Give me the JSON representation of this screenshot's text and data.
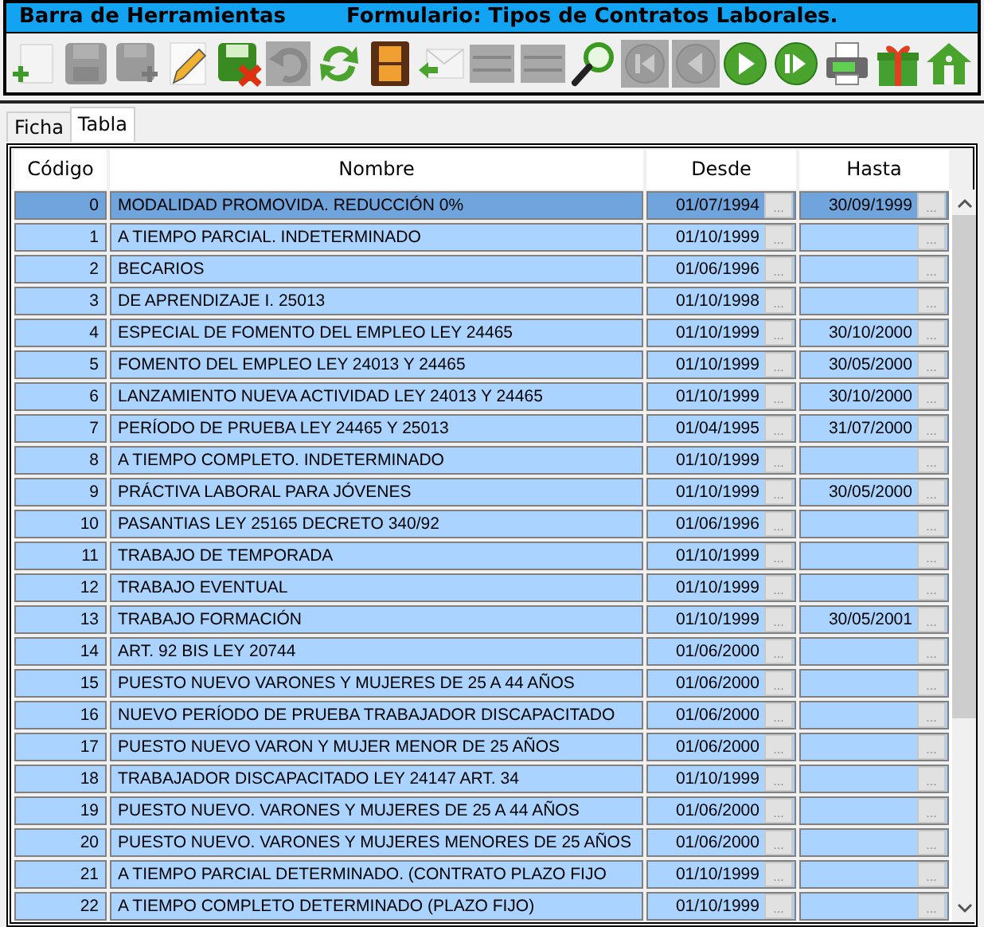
{
  "title_bar": {
    "toolbar_label": "Barra de Herramientas",
    "form_title": "Formulario: Tipos de Contratos Laborales."
  },
  "toolbar": [
    {
      "kind": "new",
      "disabled": false
    },
    {
      "kind": "save",
      "disabled": true
    },
    {
      "kind": "save_as",
      "disabled": true
    },
    {
      "kind": "edit",
      "disabled": false
    },
    {
      "kind": "cancel",
      "disabled": false
    },
    {
      "kind": "undo",
      "disabled": true
    },
    {
      "kind": "refresh",
      "disabled": false
    },
    {
      "kind": "film",
      "disabled": false
    },
    {
      "kind": "mail",
      "disabled": false
    },
    {
      "kind": "bars_add",
      "disabled": true
    },
    {
      "kind": "bars",
      "disabled": true
    },
    {
      "kind": "search",
      "disabled": false
    },
    {
      "kind": "first",
      "disabled": true
    },
    {
      "kind": "prev",
      "disabled": true
    },
    {
      "kind": "next",
      "disabled": false
    },
    {
      "kind": "last",
      "disabled": false
    },
    {
      "kind": "print",
      "disabled": false
    },
    {
      "kind": "gift",
      "disabled": false
    },
    {
      "kind": "home",
      "disabled": false
    }
  ],
  "tabs": [
    {
      "label": "Ficha",
      "selected": false
    },
    {
      "label": "Tabla",
      "selected": true
    }
  ],
  "table": {
    "columns": [
      "Código",
      "Nombre",
      "Desde",
      "Hasta"
    ],
    "rows": [
      {
        "codigo": "0",
        "nombre": "MODALIDAD PROMOVIDA. REDUCCIÓN 0%",
        "desde": "01/07/1994",
        "desde_button": "...",
        "hasta": "30/09/1999",
        "hasta_button": "...",
        "selected": true
      },
      {
        "codigo": "1",
        "nombre": "A TIEMPO PARCIAL. INDETERMINADO",
        "desde": "01/10/1999",
        "desde_button": "...",
        "hasta": "",
        "hasta_button": "...",
        "selected": false
      },
      {
        "codigo": "2",
        "nombre": "BECARIOS",
        "desde": "01/06/1996",
        "desde_button": "...",
        "hasta": "",
        "hasta_button": "...",
        "selected": false
      },
      {
        "codigo": "3",
        "nombre": "DE APRENDIZAJE I. 25013",
        "desde": "01/10/1998",
        "desde_button": "...",
        "hasta": "",
        "hasta_button": "...",
        "selected": false
      },
      {
        "codigo": "4",
        "nombre": "ESPECIAL DE FOMENTO DEL EMPLEO LEY 24465",
        "desde": "01/10/1999",
        "desde_button": "...",
        "hasta": "30/10/2000",
        "hasta_button": "...",
        "selected": false
      },
      {
        "codigo": "5",
        "nombre": "FOMENTO DEL EMPLEO LEY 24013 Y 24465",
        "desde": "01/10/1999",
        "desde_button": "...",
        "hasta": "30/05/2000",
        "hasta_button": "...",
        "selected": false
      },
      {
        "codigo": "6",
        "nombre": "LANZAMIENTO NUEVA ACTIVIDAD LEY 24013 Y 24465",
        "desde": "01/10/1999",
        "desde_button": "...",
        "hasta": "30/10/2000",
        "hasta_button": "...",
        "selected": false
      },
      {
        "codigo": "7",
        "nombre": "PERÍODO DE PRUEBA LEY 24465 Y 25013",
        "desde": "01/04/1995",
        "desde_button": "...",
        "hasta": "31/07/2000",
        "hasta_button": "...",
        "selected": false
      },
      {
        "codigo": "8",
        "nombre": "A TIEMPO COMPLETO. INDETERMINADO",
        "desde": "01/10/1999",
        "desde_button": "...",
        "hasta": "",
        "hasta_button": "...",
        "selected": false
      },
      {
        "codigo": "9",
        "nombre": "PRÁCTIVA LABORAL PARA JÓVENES",
        "desde": "01/10/1999",
        "desde_button": "...",
        "hasta": "30/05/2000",
        "hasta_button": "...",
        "selected": false
      },
      {
        "codigo": "10",
        "nombre": "PASANTIAS LEY 25165 DECRETO 340/92",
        "desde": "01/06/1996",
        "desde_button": "...",
        "hasta": "",
        "hasta_button": "...",
        "selected": false
      },
      {
        "codigo": "11",
        "nombre": "TRABAJO DE TEMPORADA",
        "desde": "01/10/1999",
        "desde_button": "...",
        "hasta": "",
        "hasta_button": "...",
        "selected": false
      },
      {
        "codigo": "12",
        "nombre": "TRABAJO EVENTUAL",
        "desde": "01/10/1999",
        "desde_button": "...",
        "hasta": "",
        "hasta_button": "...",
        "selected": false
      },
      {
        "codigo": "13",
        "nombre": "TRABAJO FORMACIÓN",
        "desde": "01/10/1999",
        "desde_button": "...",
        "hasta": "30/05/2001",
        "hasta_button": "...",
        "selected": false
      },
      {
        "codigo": "14",
        "nombre": "ART. 92 BIS LEY 20744",
        "desde": "01/06/2000",
        "desde_button": "...",
        "hasta": "",
        "hasta_button": "...",
        "selected": false
      },
      {
        "codigo": "15",
        "nombre": "PUESTO NUEVO VARONES Y MUJERES DE 25 A 44 AÑOS",
        "desde": "01/06/2000",
        "desde_button": "...",
        "hasta": "",
        "hasta_button": "...",
        "selected": false
      },
      {
        "codigo": "16",
        "nombre": "NUEVO PERÍODO DE PRUEBA TRABAJADOR DISCAPACITADO",
        "desde": "01/06/2000",
        "desde_button": "...",
        "hasta": "",
        "hasta_button": "...",
        "selected": false
      },
      {
        "codigo": "17",
        "nombre": "PUESTO NUEVO VARON Y MUJER MENOR DE 25 AÑOS",
        "desde": "01/06/2000",
        "desde_button": "...",
        "hasta": "",
        "hasta_button": "...",
        "selected": false
      },
      {
        "codigo": "18",
        "nombre": "TRABAJADOR DISCAPACITADO LEY 24147 ART. 34",
        "desde": "01/10/1999",
        "desde_button": "...",
        "hasta": "",
        "hasta_button": "...",
        "selected": false
      },
      {
        "codigo": "19",
        "nombre": "PUESTO NUEVO. VARONES Y MUJERES DE 25 A 44 AÑOS",
        "desde": "01/06/2000",
        "desde_button": "...",
        "hasta": "",
        "hasta_button": "...",
        "selected": false
      },
      {
        "codigo": "20",
        "nombre": "PUESTO NUEVO. VARONES Y MUJERES MENORES DE 25 AÑOS",
        "desde": "01/06/2000",
        "desde_button": "...",
        "hasta": "",
        "hasta_button": "...",
        "selected": false
      },
      {
        "codigo": "21",
        "nombre": "A TIEMPO PARCIAL DETERMINADO. (CONTRATO PLAZO FIJO",
        "desde": "01/10/1999",
        "desde_button": "...",
        "hasta": "",
        "hasta_button": "...",
        "selected": false
      },
      {
        "codigo": "22",
        "nombre": "A TIEMPO COMPLETO DETERMINADO (PLAZO FIJO)",
        "desde": "01/10/1999",
        "desde_button": "...",
        "hasta": "",
        "hasta_button": "...",
        "selected": false
      }
    ]
  }
}
